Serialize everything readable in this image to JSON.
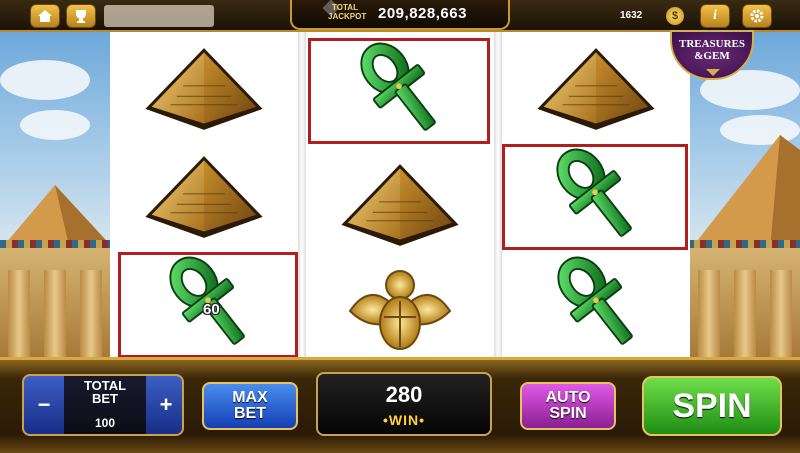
{
  "top_bar": {
    "home_icon": "home-icon",
    "trophy_icon": "trophy-icon",
    "jackpot_label": "TOTAL JACKPOT",
    "jackpot_value": "209,828,663",
    "coins": "1632",
    "coin_icon": "$",
    "info_icon": "i",
    "settings_icon": "gear-icon"
  },
  "bonus_badge": {
    "title_line1": "TREASURES",
    "title_line2": "&GEM"
  },
  "reels": [
    {
      "symbols": [
        "pyramid",
        "pyramid",
        "ankh"
      ],
      "win_frames": [
        false,
        false,
        true
      ],
      "win_labels": [
        "",
        "",
        "60"
      ]
    },
    {
      "symbols": [
        "ankh",
        "pyramid",
        "scarab"
      ],
      "win_frames": [
        true,
        false,
        false
      ]
    },
    {
      "symbols": [
        "pyramid",
        "ankh",
        "ankh"
      ],
      "win_frames": [
        false,
        true,
        false
      ]
    }
  ],
  "controls": {
    "total_bet_label_1": "TOTAL",
    "total_bet_label_2": "BET",
    "total_bet_value": "100",
    "minus_label": "−",
    "plus_label": "+",
    "max_bet_line1": "MAX",
    "max_bet_line2": "BET",
    "win_value": "280",
    "win_label": "•WIN•",
    "auto_spin_line1": "AUTO",
    "auto_spin_line2": "SPIN",
    "spin_label": "SPIN"
  },
  "colors": {
    "win_frame": "#b11e1e",
    "ankh": "#1f9b2e",
    "pyramid": "#c9962a",
    "gold_trim": "#d8a93c"
  }
}
